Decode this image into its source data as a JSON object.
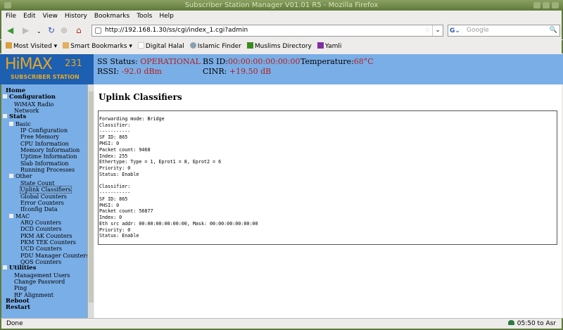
{
  "window": {
    "title": "Subscriber Station Manager V01.01 R5 - Mozilla Firefox"
  },
  "menu": [
    "File",
    "Edit",
    "View",
    "History",
    "Bookmarks",
    "Tools",
    "Help"
  ],
  "navbar": {
    "url": "http://192.168.1.30/ss/cgi/index_1.cgi?admin",
    "search_placeholder": "Google"
  },
  "bookmarks": [
    {
      "label": "Most Visited ▾",
      "icon": "folder-icon",
      "color": "#d8a040"
    },
    {
      "label": "Smart Bookmarks ▾",
      "icon": "folder-icon",
      "color": "#e0b060"
    },
    {
      "label": "Digital Halal",
      "icon": "dh-icon",
      "color": "#ffffff"
    },
    {
      "label": "Islamic Finder",
      "icon": "globe-icon",
      "color": "#8aa0b0"
    },
    {
      "label": "Muslims Directory",
      "icon": "directory-icon",
      "color": "#3a8a20"
    },
    {
      "label": "Yamli",
      "icon": "yamli-icon",
      "color": "#8030a0"
    }
  ],
  "header": {
    "logo_main": "HiMAX",
    "logo_num": "231",
    "logo_sub": "SUBSCRIBER STATION",
    "ss_status_label": "SS Status:",
    "ss_status": "OPERATIONAL",
    "bs_id_label": "BS ID:",
    "bs_id": "00:00:00:00:00:00",
    "temp_label": "Temperature:",
    "temp": "68°C",
    "rssi_label": "RSSI:",
    "rssi": "-92.0 dBm",
    "cinr_label": "CINR:",
    "cinr": "+19.50 dB"
  },
  "sidebar": [
    {
      "label": "Home",
      "level": 0,
      "bold": true
    },
    {
      "label": "Configuration",
      "level": 0,
      "bold": true,
      "toggle": true
    },
    {
      "label": "WiMAX Radio",
      "level": 1
    },
    {
      "label": "Network",
      "level": 1
    },
    {
      "label": "Stats",
      "level": 0,
      "bold": true,
      "toggle": true
    },
    {
      "label": "Basic",
      "level": 1,
      "toggle": true
    },
    {
      "label": "IP Configuration",
      "level": 2
    },
    {
      "label": "Free Memory",
      "level": 2
    },
    {
      "label": "CPU Information",
      "level": 2
    },
    {
      "label": "Memory Information",
      "level": 2
    },
    {
      "label": "Uptime Information",
      "level": 2
    },
    {
      "label": "Slab Information",
      "level": 2
    },
    {
      "label": "Running Processes",
      "level": 2
    },
    {
      "label": "Other",
      "level": 1,
      "toggle": true
    },
    {
      "label": "State Count",
      "level": 2
    },
    {
      "label": "Uplink Classifiers",
      "level": 2,
      "selected": true
    },
    {
      "label": "Global Counters",
      "level": 2
    },
    {
      "label": "Error Counters",
      "level": 2
    },
    {
      "label": "Ifconfig Data",
      "level": 2
    },
    {
      "label": "MAC",
      "level": 1,
      "toggle": true
    },
    {
      "label": "ARQ Counters",
      "level": 2
    },
    {
      "label": "DCD Counters",
      "level": 2
    },
    {
      "label": "PKM AK Counters",
      "level": 2
    },
    {
      "label": "PKM TEK Counters",
      "level": 2
    },
    {
      "label": "UCD Counters",
      "level": 2
    },
    {
      "label": "PDU Manager Counters",
      "level": 2
    },
    {
      "label": "QOS Counters",
      "level": 2
    },
    {
      "label": "Utilities",
      "level": 0,
      "bold": true,
      "toggle": true
    },
    {
      "label": "Management Users",
      "level": 1
    },
    {
      "label": "Change Password",
      "level": 1
    },
    {
      "label": "Ping",
      "level": 1
    },
    {
      "label": "RF Alignment",
      "level": 1
    },
    {
      "label": "Reboot",
      "level": 0,
      "bold": true
    },
    {
      "label": "Restart",
      "level": 0,
      "bold": true
    }
  ],
  "main": {
    "title": "Uplink Classifiers",
    "lines": [
      "Forwarding mode: Bridge",
      "Classifier:",
      "-----------",
      "SF ID: 865",
      "PHSI: 0",
      "Packet count: 9468",
      "Index: 255",
      "Ethertype: Type = 1, Eprot1 = 8, Eprot2 = 6",
      "Priority: 0",
      "Status: Enable",
      "",
      "Classifier:",
      "-----------",
      "SF ID: 865",
      "PHSI: 0",
      "Packet count: 56877",
      "Index: 0",
      "Eth src addr: 00:00:00:00:00:00, Mask: 00:00:00:00:00:00",
      "Priority: 0",
      "Status: Enable"
    ]
  },
  "statusbar": {
    "left": "Done",
    "right": "05:50 to Asr"
  }
}
